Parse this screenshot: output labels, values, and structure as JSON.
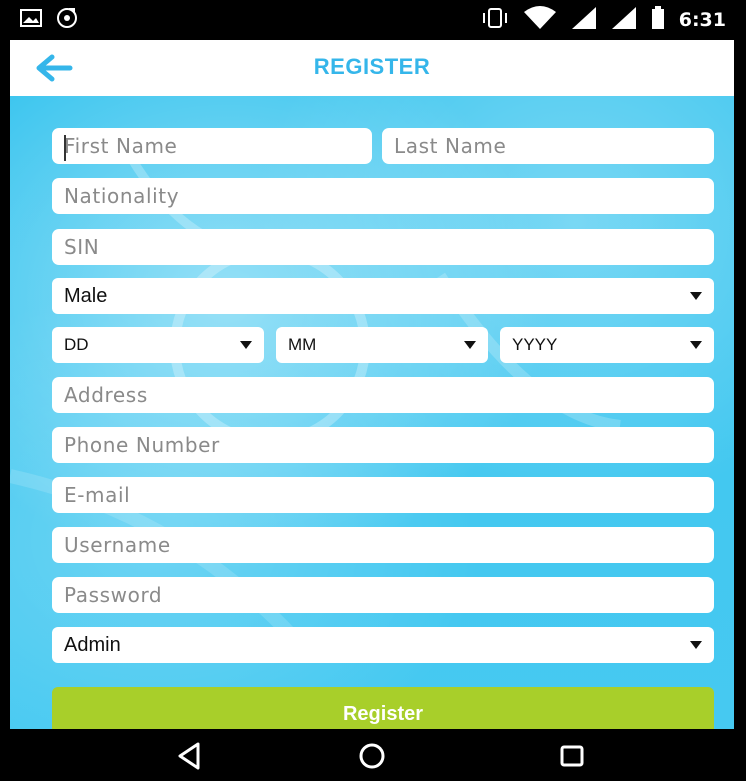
{
  "status_bar": {
    "time": "6:31",
    "icons": [
      "gallery-icon",
      "music-icon",
      "vibrate-icon",
      "wifi-icon",
      "signal-icon",
      "signal-icon",
      "battery-icon"
    ]
  },
  "header": {
    "title": "REGISTER",
    "back_icon": "arrow-left-icon"
  },
  "form": {
    "first_name": {
      "placeholder": "First Name",
      "value": ""
    },
    "last_name": {
      "placeholder": "Last Name",
      "value": ""
    },
    "nationality": {
      "placeholder": "Nationality",
      "value": ""
    },
    "sin": {
      "placeholder": "SIN",
      "value": ""
    },
    "gender": {
      "selected": "Male"
    },
    "dob": {
      "day": "DD",
      "month": "MM",
      "year": "YYYY"
    },
    "address": {
      "placeholder": "Address",
      "value": ""
    },
    "phone": {
      "placeholder": "Phone Number",
      "value": ""
    },
    "email": {
      "placeholder": "E-mail",
      "value": ""
    },
    "username": {
      "placeholder": "Username",
      "value": ""
    },
    "password": {
      "placeholder": "Password",
      "value": ""
    },
    "role": {
      "selected": "Admin"
    },
    "submit_label": "Register"
  },
  "nav_bar": {
    "icons": [
      "back-triangle-icon",
      "home-circle-icon",
      "recents-square-icon"
    ]
  },
  "colors": {
    "accent": "#35b6ea",
    "background": "#42c8f0",
    "button": "#a8cf2a"
  }
}
